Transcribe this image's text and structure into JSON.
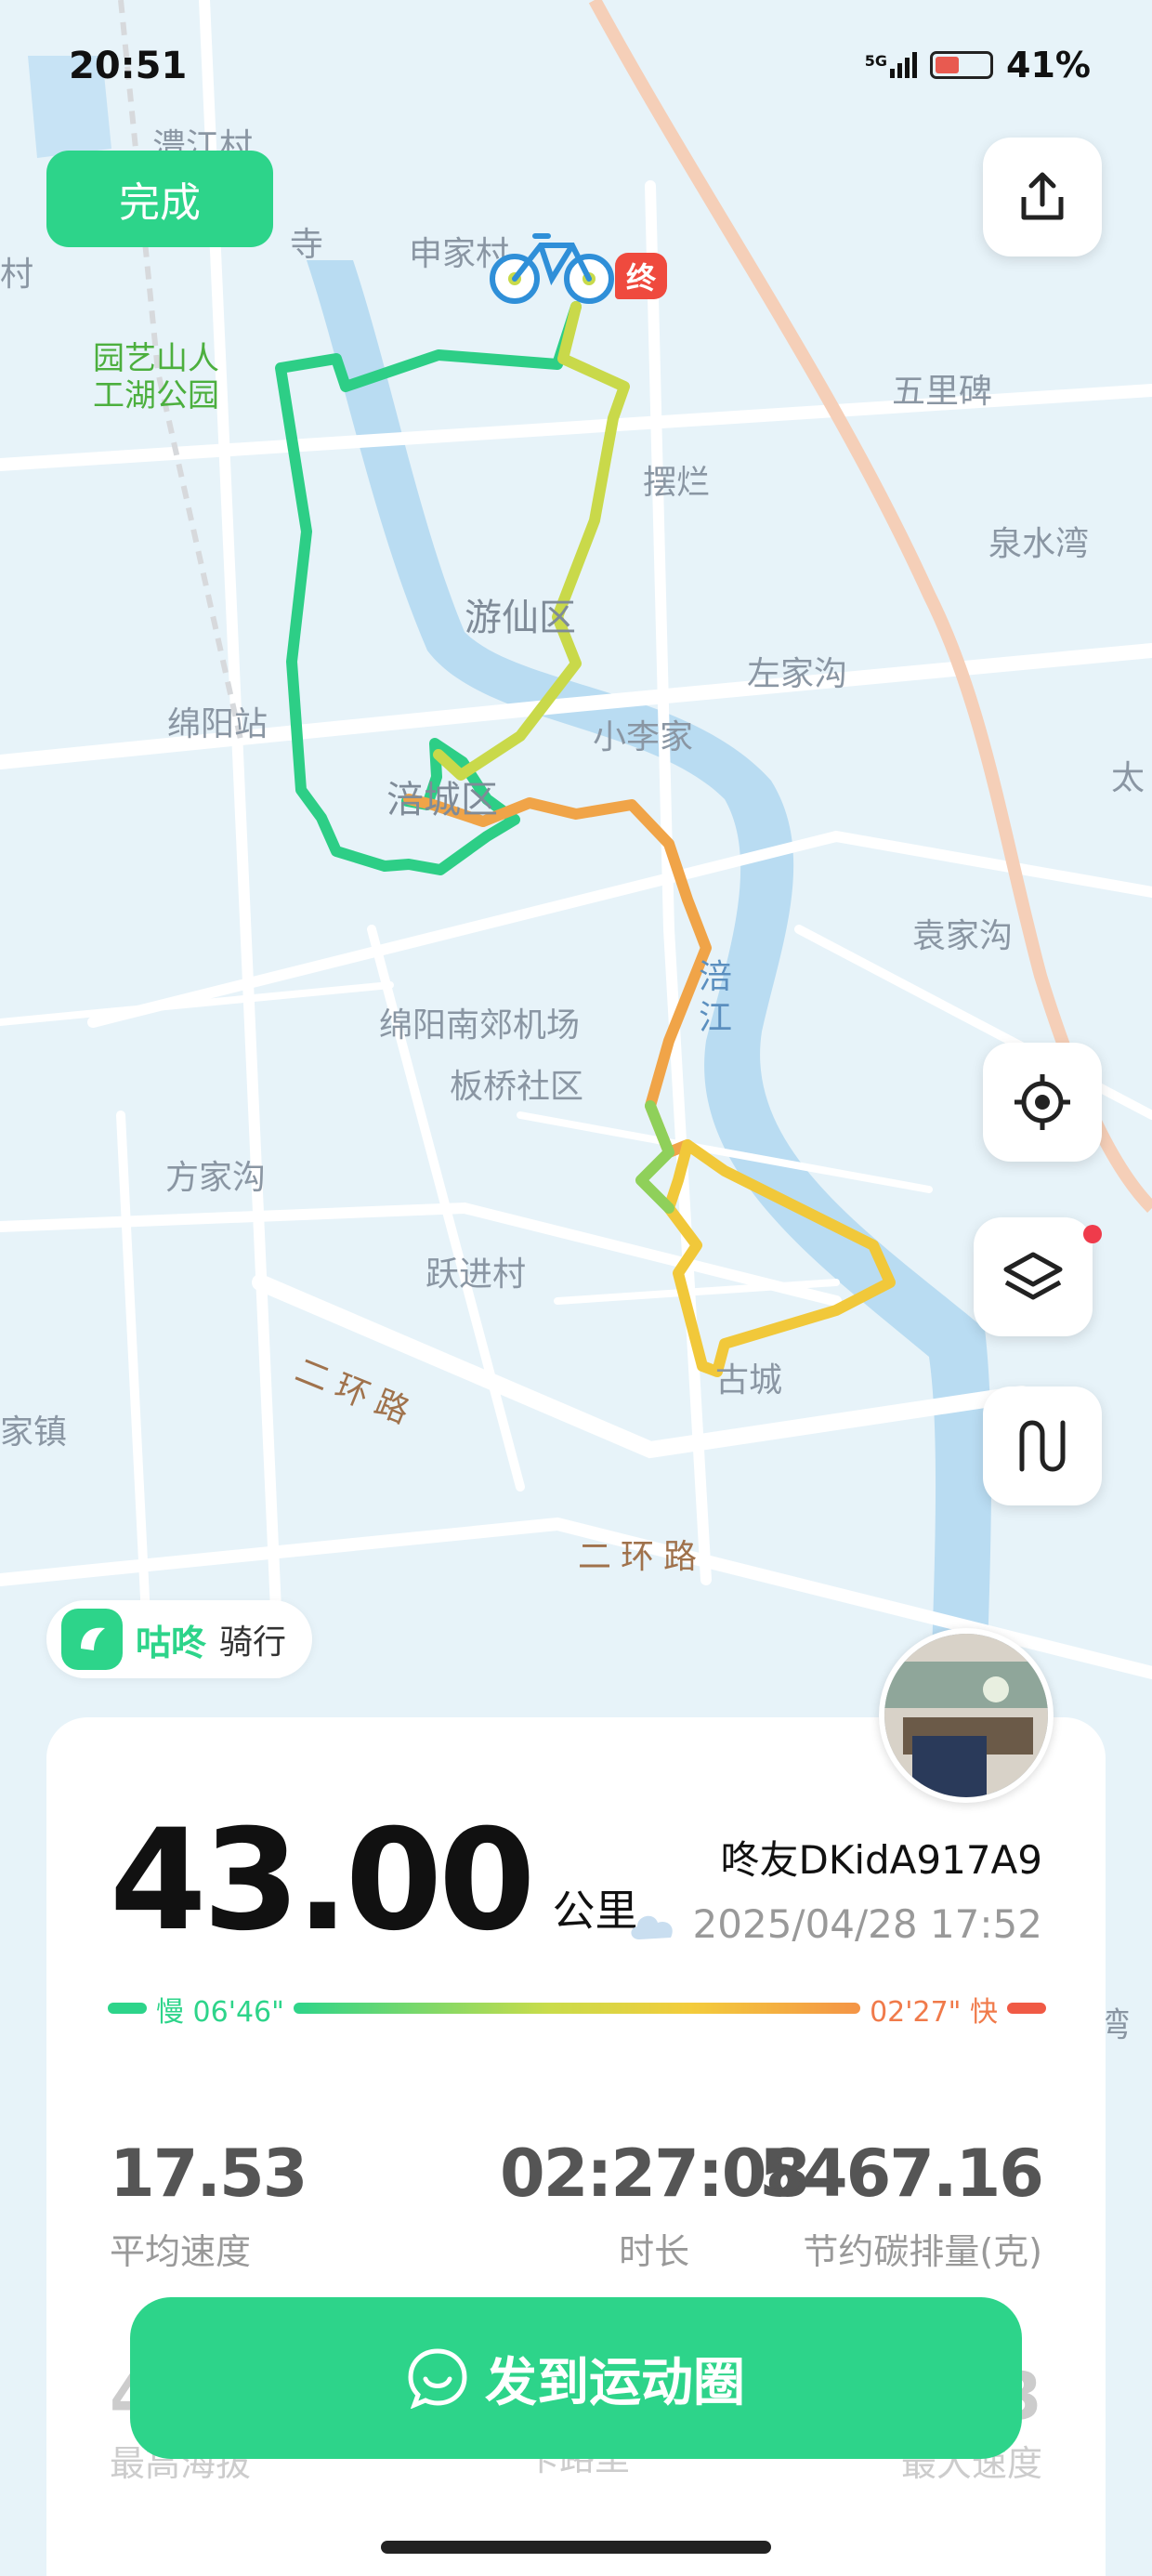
{
  "status_bar": {
    "time": "20:51",
    "network": "5G",
    "battery": "41%"
  },
  "map": {
    "done_button": "完成",
    "labels": {
      "jiangcun": "澧江村",
      "shenjia": "申家村",
      "si": "寺",
      "cun_left": "村",
      "park": "园艺山人\n工湖公园",
      "wulibei": "五里碑",
      "bailan": "摆烂",
      "quanshuiwan": "泉水湾",
      "youxian": "游仙区",
      "zuojiagou": "左家沟",
      "mianyang_station": "绵阳站",
      "xiaolijia": "小李家",
      "fucheng": "涪城区",
      "tai": "太",
      "yuanjiagou": "袁家沟",
      "airport": "绵阳南郊机场",
      "fujiang": "涪江",
      "banqiao": "板桥社区",
      "fangjiagou": "方家沟",
      "yuejin": "跃进村",
      "gucheng": "古城",
      "erhuan1": "二环路",
      "jiazhen": "家镇",
      "erhuan2": "二环路",
      "wan": "湾",
      "end_tag": "终"
    },
    "icons": {
      "share": "share-icon",
      "locate": "locate-icon",
      "layers": "layers-icon",
      "route": "route-icon",
      "bike": "bicycle-icon"
    }
  },
  "brand": {
    "name": "咕咚",
    "subtitle": "骑行"
  },
  "summary": {
    "distance": "43.00",
    "distance_unit": "公里",
    "username": "咚友DKidA917A9",
    "datetime": "2025/04/28 17:52",
    "weather_icon": "cloud-icon",
    "pace_slow": "慢 06'46\"",
    "pace_fast": "02'27\" 快",
    "pace_colors": {
      "slow": "#2dd48a",
      "fast": "#f05a45"
    },
    "stats": [
      {
        "value": "17.53",
        "label": "平均速度"
      },
      {
        "value": "02:27:08",
        "label": "时长"
      },
      {
        "value": "5467.16",
        "label": "节约碳排量(克)"
      }
    ],
    "stats_partial": [
      {
        "value": "4",
        "label": "最高海拔"
      },
      {
        "value": "",
        "label": "卡路里"
      },
      {
        "value": "3",
        "label": "最大速度"
      }
    ]
  },
  "share_button": "发到运动圈",
  "accent": "#2dd48a"
}
